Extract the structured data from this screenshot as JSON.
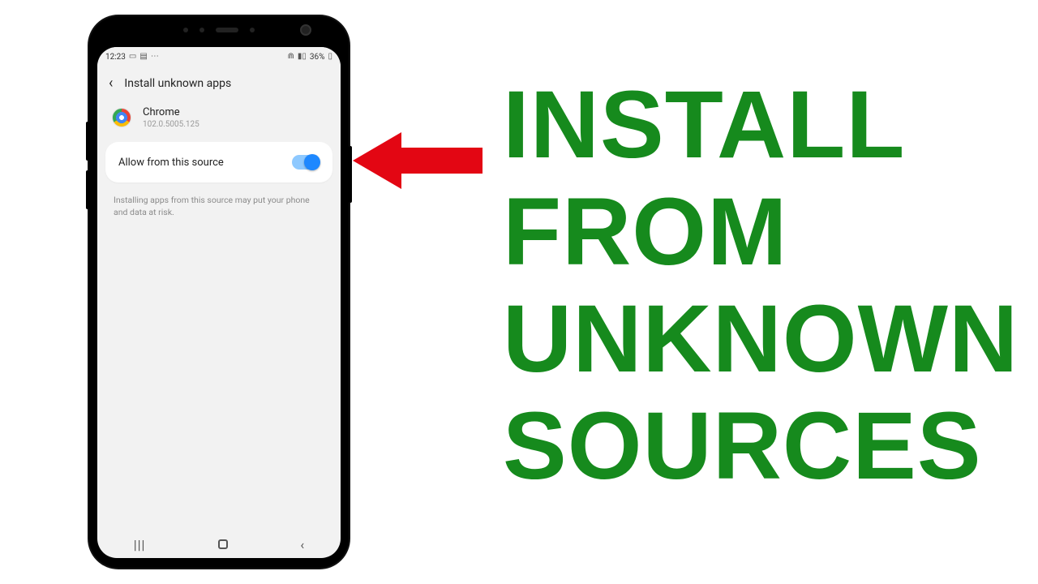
{
  "statusbar": {
    "time": "12:23",
    "battery_text": "36%"
  },
  "header": {
    "title": "Install unknown apps"
  },
  "app": {
    "name": "Chrome",
    "version": "102.0.5005.125"
  },
  "setting": {
    "label": "Allow from this source",
    "enabled": true
  },
  "warning": "Installing apps from this source may put your phone and data at risk.",
  "overlay": {
    "line1": "INSTALL",
    "line2": "FROM",
    "line3": "UNKNOWN",
    "line4": "SOURCES"
  },
  "colors": {
    "accent_green": "#168a1d",
    "arrow_red": "#e30613",
    "toggle_blue": "#1e88ff"
  }
}
